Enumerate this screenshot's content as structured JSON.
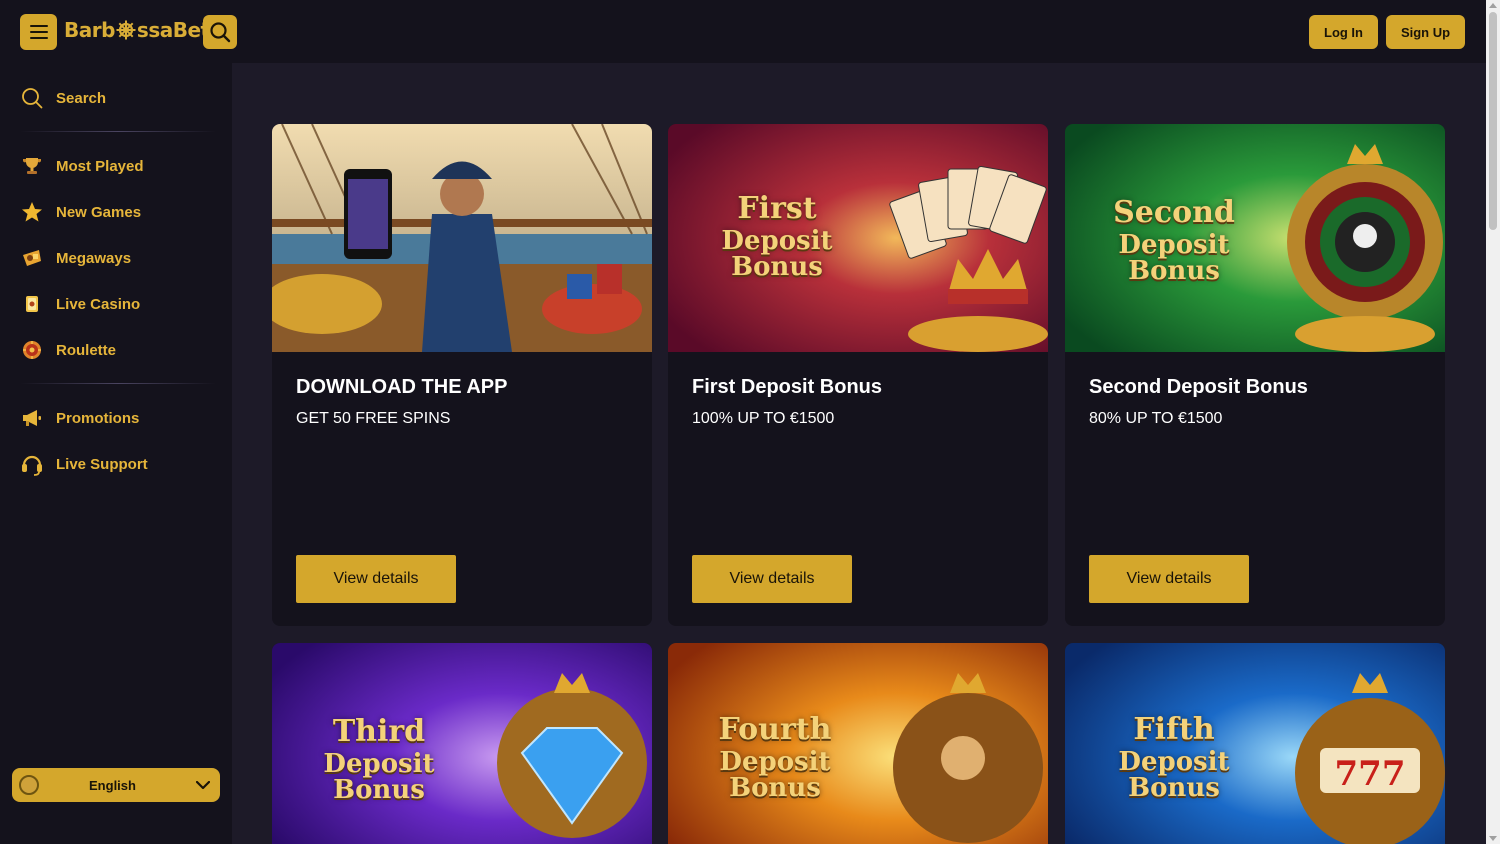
{
  "header": {
    "logo_text_left": "Barb",
    "logo_text_right": "ssaBet",
    "login_label": "Log In",
    "signup_label": "Sign Up"
  },
  "sidebar": {
    "search_label": "Search",
    "items": [
      {
        "label": "Most Played",
        "icon": "trophy-icon"
      },
      {
        "label": "New Games",
        "icon": "star-icon"
      },
      {
        "label": "Megaways",
        "icon": "megaways-icon"
      },
      {
        "label": "Live Casino",
        "icon": "cards-icon"
      },
      {
        "label": "Roulette",
        "icon": "roulette-icon"
      }
    ],
    "secondary_items": [
      {
        "label": "Promotions",
        "icon": "megaphone-icon"
      },
      {
        "label": "Live Support",
        "icon": "headset-icon"
      }
    ],
    "language": "English"
  },
  "promotions": [
    {
      "title": "DOWNLOAD THE APP",
      "subtitle": "GET 50 FREE SPINS",
      "button": "View details",
      "image_line1": "",
      "image_line2": ""
    },
    {
      "title": "First Deposit Bonus",
      "subtitle": "100% UP TO €1500",
      "button": "View details",
      "image_line1": "First",
      "image_line2": "Deposit Bonus"
    },
    {
      "title": "Second Deposit Bonus",
      "subtitle": "80% UP TO €1500",
      "button": "View details",
      "image_line1": "Second",
      "image_line2": "Deposit Bonus"
    },
    {
      "image_line1": "Third",
      "image_line2": "Deposit Bonus"
    },
    {
      "image_line1": "Fourth",
      "image_line2": "Deposit Bonus"
    },
    {
      "image_line1": "Fifth",
      "image_line2": "Deposit Bonus"
    }
  ],
  "colors": {
    "accent": "#d4a72c",
    "background": "#14121c",
    "main_bg": "#1d1a28"
  }
}
